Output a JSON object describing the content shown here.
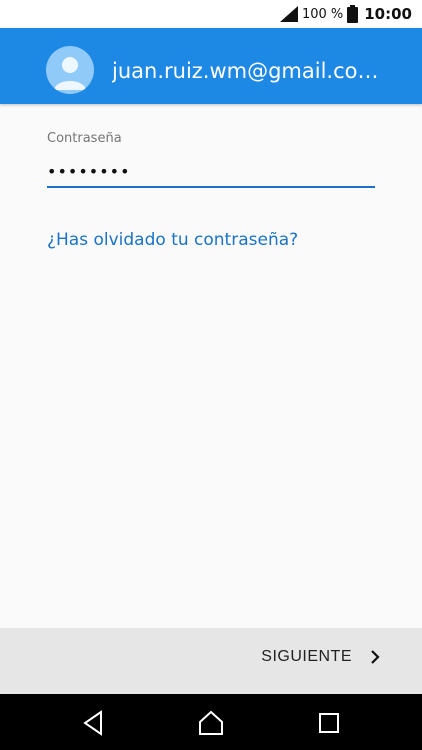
{
  "status_bar": {
    "battery_percent": "100 %",
    "time": "10:00",
    "icons": [
      "signal-icon",
      "battery-icon"
    ]
  },
  "header": {
    "email": "juan.ruiz.wm@gmail.co…",
    "avatar_icon": "person-icon",
    "color": "#1e88e5"
  },
  "form": {
    "password_label": "Contraseña",
    "password_value": "••••••••",
    "forgot_link": "¿Has olvidado tu contraseña?"
  },
  "footer": {
    "next_label": "SIGUIENTE",
    "next_icon": "chevron-right-icon"
  },
  "navigation": {
    "icons": [
      "back-icon",
      "home-icon",
      "recents-icon"
    ]
  },
  "colors": {
    "accent": "#1e88e5",
    "link": "#1a73c8",
    "background": "#fafafa",
    "footer": "#e6e6e6"
  }
}
